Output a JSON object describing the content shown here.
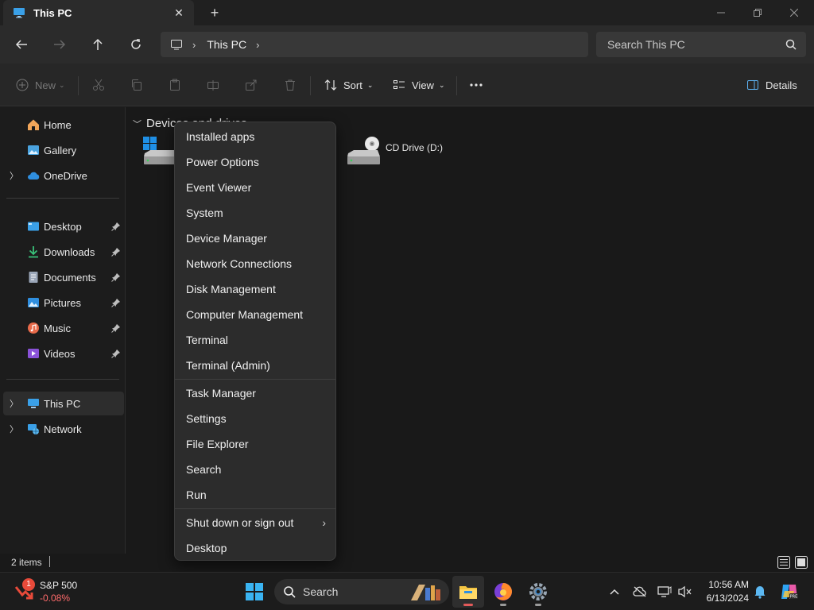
{
  "window": {
    "tab_title": "This PC"
  },
  "address": {
    "crumb": "This PC"
  },
  "search": {
    "placeholder": "Search This PC"
  },
  "commandbar": {
    "new_label": "New",
    "sort_label": "Sort",
    "view_label": "View",
    "details_label": "Details"
  },
  "sidebar": {
    "home": "Home",
    "gallery": "Gallery",
    "onedrive": "OneDrive",
    "quick_access": [
      {
        "label": "Desktop"
      },
      {
        "label": "Downloads"
      },
      {
        "label": "Documents"
      },
      {
        "label": "Pictures"
      },
      {
        "label": "Music"
      },
      {
        "label": "Videos"
      }
    ],
    "this_pc": "This PC",
    "network": "Network"
  },
  "main": {
    "group_header": "Devices and drives",
    "cd_drive_label": "CD Drive (D:)"
  },
  "status": {
    "items": "2 items"
  },
  "context_menu": {
    "group1": [
      "Installed apps",
      "Power Options",
      "Event Viewer",
      "System",
      "Device Manager",
      "Network Connections",
      "Disk Management",
      "Computer Management",
      "Terminal",
      "Terminal (Admin)"
    ],
    "group2": [
      "Task Manager",
      "Settings",
      "File Explorer",
      "Search",
      "Run"
    ],
    "shutdown": "Shut down or sign out",
    "desktop": "Desktop"
  },
  "taskbar": {
    "widget_name": "S&P 500",
    "widget_change": "-0.08%",
    "widget_badge": "1",
    "search_label": "Search",
    "time": "10:56 AM",
    "date": "6/13/2024"
  },
  "colors": {
    "accent": "#0078d4",
    "folder_yellow": "#f4c542",
    "negative": "#ff6b6b"
  }
}
